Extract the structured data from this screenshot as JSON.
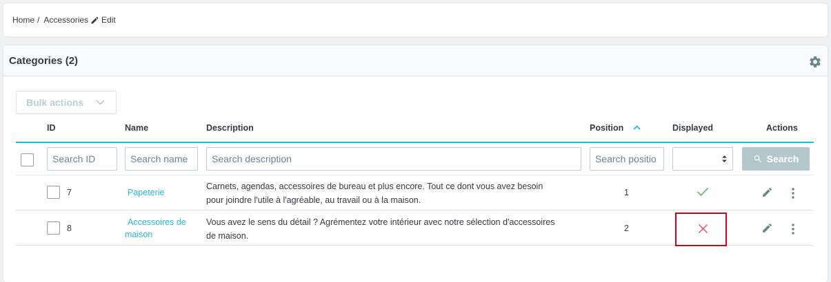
{
  "breadcrumb": {
    "home": "Home",
    "separator": "/",
    "section": "Accessories",
    "current": "Edit"
  },
  "panel": {
    "title": "Categories (2)"
  },
  "toolbar": {
    "bulk_actions": "Bulk actions"
  },
  "table": {
    "columns": {
      "id": "ID",
      "name": "Name",
      "description": "Description",
      "position": "Position",
      "displayed": "Displayed",
      "actions": "Actions"
    },
    "filters": {
      "id_placeholder": "Search ID",
      "name_placeholder": "Search name",
      "description_placeholder": "Search description",
      "position_placeholder": "Search positio",
      "search_button": "Search"
    },
    "rows": [
      {
        "id": "7",
        "name": "Papeterie",
        "description_line1": "Carnets, agendas, accessoires de bureau et plus encore. Tout ce dont vous avez besoin",
        "description_line2": "pour joindre l'utile à l'agréable, au travail ou à la maison.",
        "position": "1",
        "displayed": true
      },
      {
        "id": "8",
        "name_line1": "Accessoires de",
        "name_line2": "maison",
        "description_line1": "Vous avez le sens du détail ? Agrémentez votre intérieur avec notre sélection d'accessoires",
        "description_line2": "de maison.",
        "position": "2",
        "displayed": false
      }
    ]
  },
  "colors": {
    "accent": "#25b9d7",
    "success": "#70b580",
    "danger": "#e76d7a",
    "highlight_box": "#d0021b"
  }
}
